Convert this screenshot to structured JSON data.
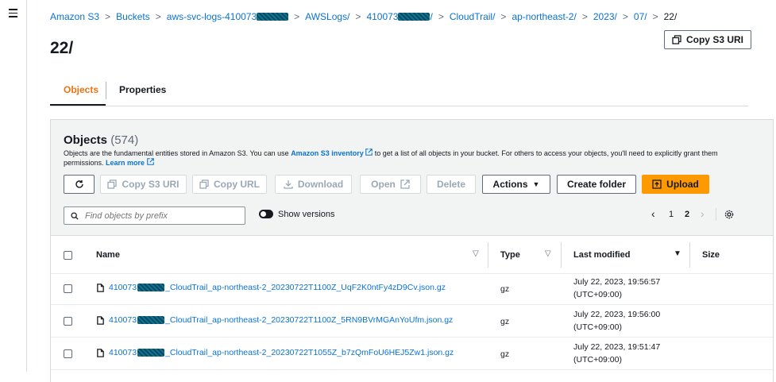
{
  "breadcrumbs": [
    "Amazon S3",
    "Buckets",
    "aws-svc-logs-410073",
    "AWSLogs/",
    "410073",
    "CloudTrail/",
    "ap-northeast-2/",
    "2023/",
    "07/",
    "22/"
  ],
  "page_title": "22/",
  "copy_s3_uri_top": "Copy S3 URI",
  "tabs": [
    {
      "label": "Objects"
    },
    {
      "label": "Properties"
    }
  ],
  "objects": {
    "title": "Objects",
    "count": "(574)",
    "desc_part1": "Objects are the fundamental entities stored in Amazon S3. You can use ",
    "desc_link1": "Amazon S3 inventory",
    "desc_part2": " to get a list of all objects in your bucket. For others to access your objects, you'll need to explicitly grant them permissions.",
    "desc_link2": "Learn more"
  },
  "toolbar": {
    "copy_s3_uri": "Copy S3 URI",
    "copy_url": "Copy URL",
    "download": "Download",
    "open": "Open",
    "delete": "Delete",
    "actions": "Actions",
    "create_folder": "Create folder",
    "upload": "Upload"
  },
  "search": {
    "placeholder": "Find objects by prefix",
    "value": ""
  },
  "show_versions": "Show versions",
  "pagination": {
    "page1": "1",
    "page2": "2",
    "current": "2"
  },
  "table": {
    "headers": {
      "name": "Name",
      "type": "Type",
      "last_modified": "Last modified",
      "size": "Size"
    },
    "rows": [
      {
        "prefix": "410073",
        "name": "_CloudTrail_ap-northeast-2_20230722T1100Z_UqF2K0ntFy4zD9Cv.json.gz",
        "type": "gz",
        "date": "July 22, 2023, 19:56:57",
        "tz": "(UTC+09:00)"
      },
      {
        "prefix": "410073",
        "name": "_CloudTrail_ap-northeast-2_20230722T1100Z_5RN9BVrMGAnYoUfm.json.gz",
        "type": "gz",
        "date": "July 22, 2023, 19:56:00",
        "tz": "(UTC+09:00)"
      },
      {
        "prefix": "410073",
        "name": "_CloudTrail_ap-northeast-2_20230722T1055Z_b7zQmFoU6HEJ5Zw1.json.gz",
        "type": "gz",
        "date": "July 22, 2023, 19:51:47",
        "tz": "(UTC+09:00)"
      }
    ]
  },
  "colors": {
    "accent": "#ec7211",
    "link": "#0972d3",
    "primary_button": "#ff9900",
    "header_bg": "#f2f3f3"
  }
}
